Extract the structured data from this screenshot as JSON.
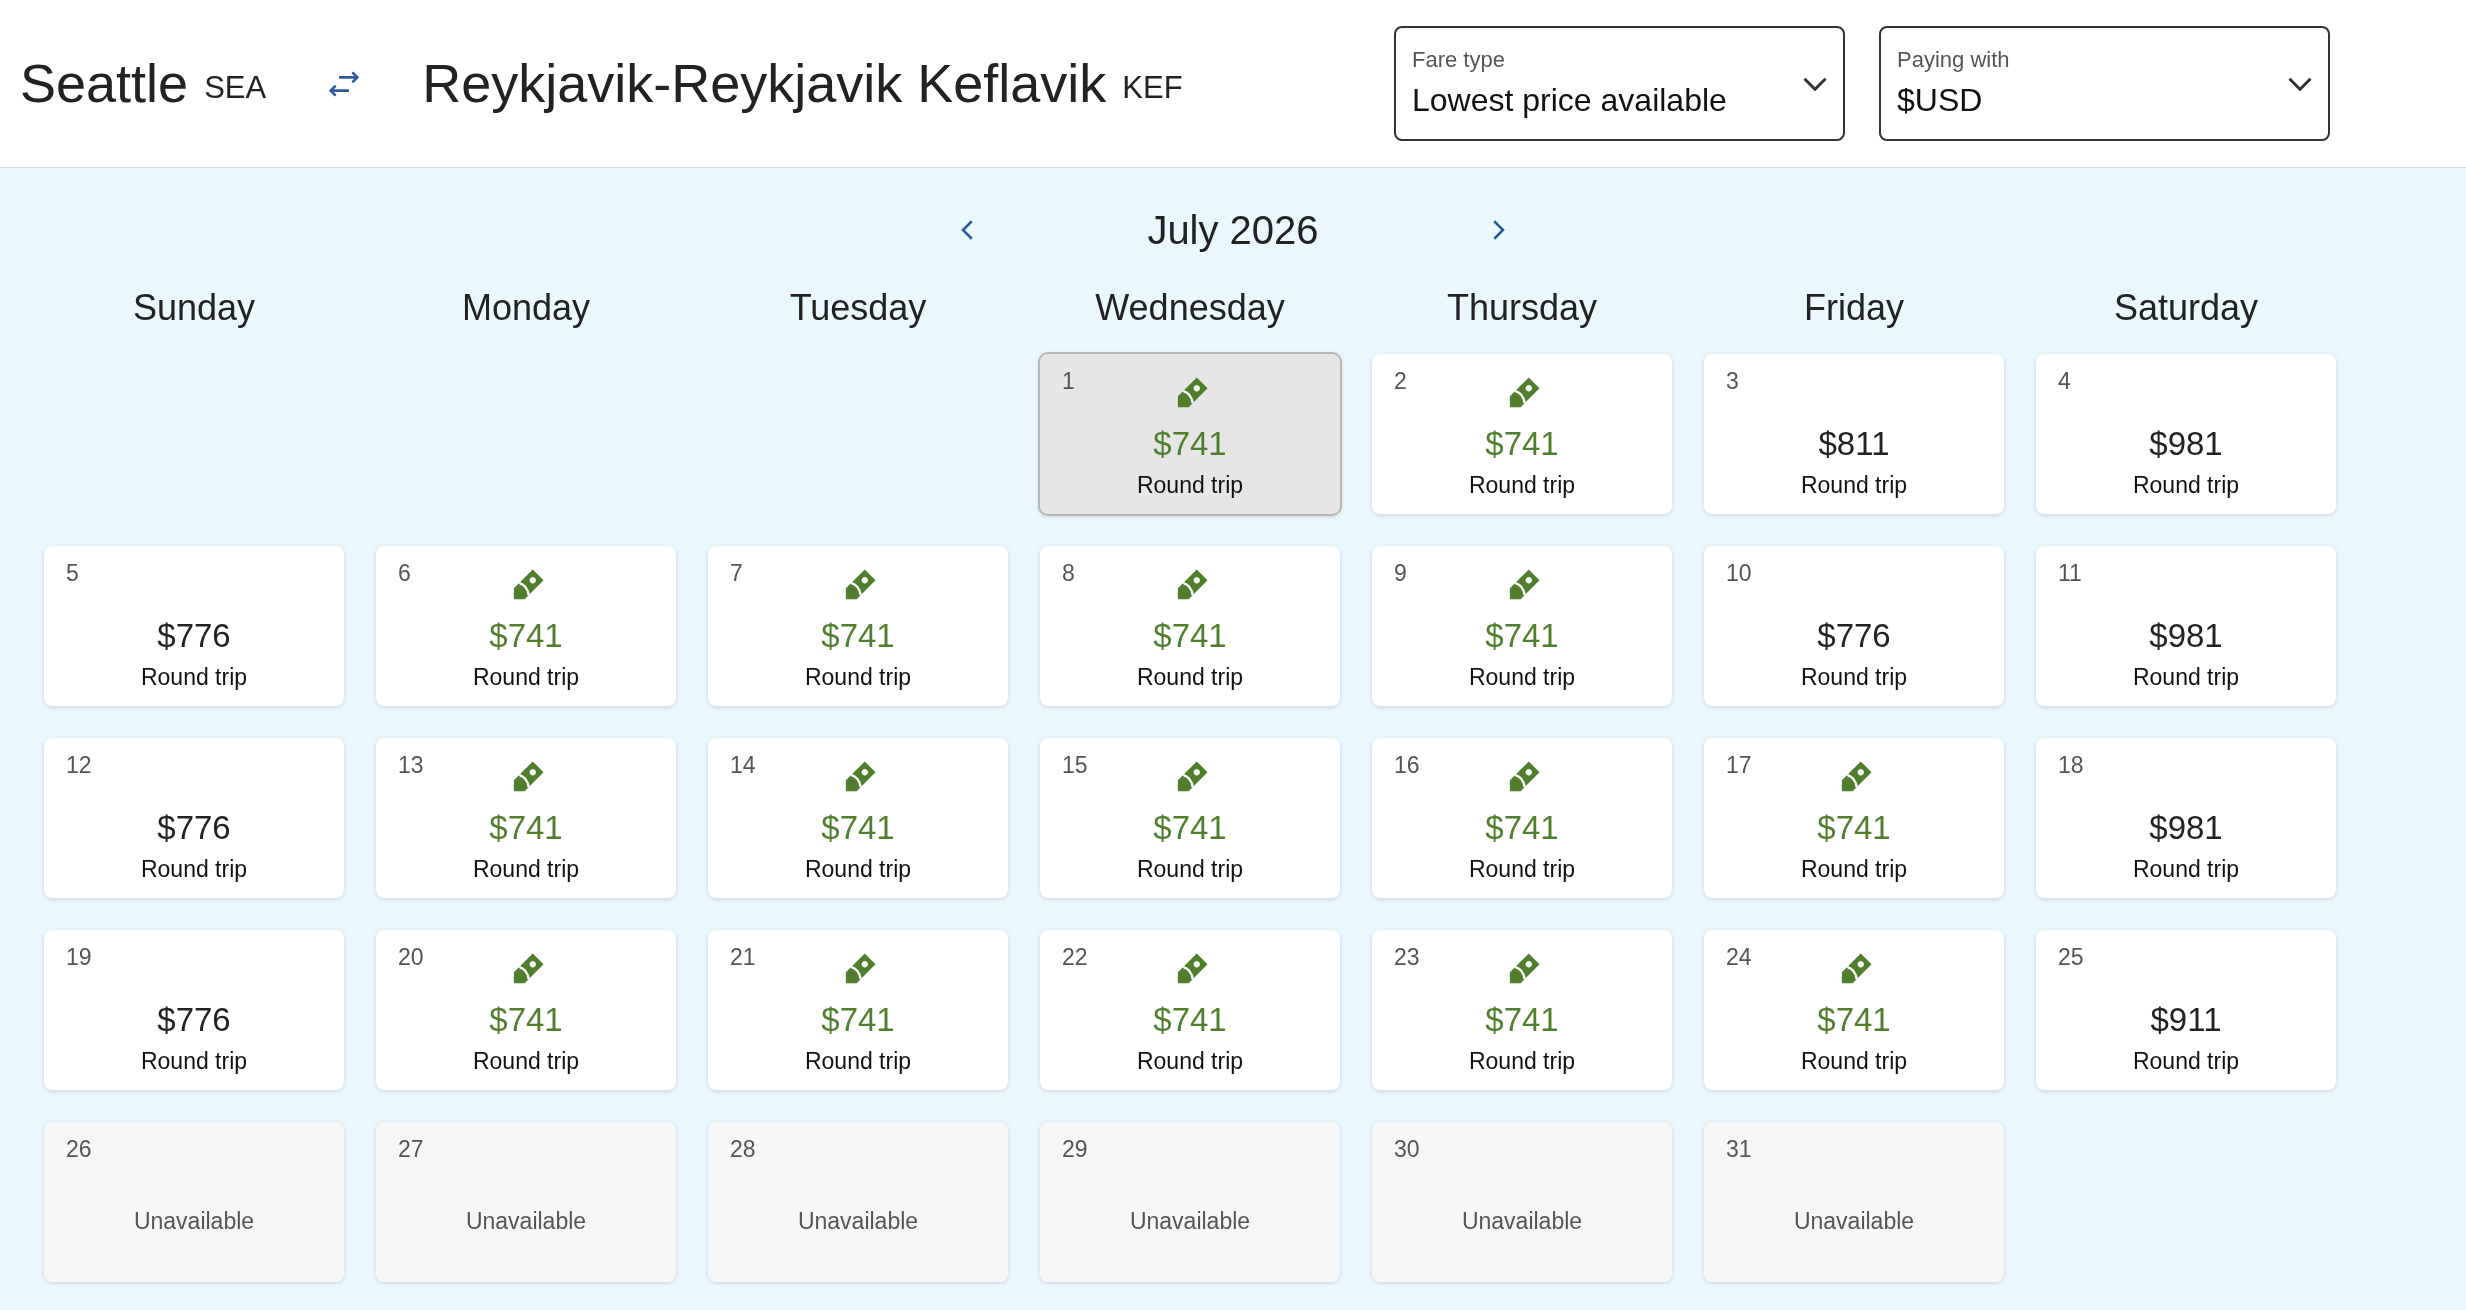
{
  "header": {
    "origin": {
      "city": "Seattle",
      "code": "SEA"
    },
    "destination": {
      "city": "Reykjavik-Reykjavik Keflavik",
      "code": "KEF"
    },
    "dropdowns": [
      {
        "label": "Fare type",
        "value": "Lowest price available"
      },
      {
        "label": "Paying with",
        "value": "$USD"
      }
    ]
  },
  "calendar": {
    "month": "July 2026",
    "weekdays": [
      "Sunday",
      "Monday",
      "Tuesday",
      "Wednesday",
      "Thursday",
      "Friday",
      "Saturday"
    ],
    "weeks": [
      [
        {
          "day": "1",
          "kind": "deal",
          "price": "$741",
          "note": "Round trip",
          "selected": true
        },
        {
          "day": "2",
          "kind": "deal",
          "price": "$741",
          "note": "Round trip",
          "selected": false
        },
        {
          "day": "3",
          "kind": "regular",
          "price": "$811",
          "note": "Round trip",
          "selected": false
        },
        {
          "day": "4",
          "kind": "regular",
          "price": "$981",
          "note": "Round trip",
          "selected": false
        }
      ],
      [
        {
          "day": "5",
          "kind": "regular",
          "price": "$776",
          "note": "Round trip",
          "selected": false
        },
        {
          "day": "6",
          "kind": "deal",
          "price": "$741",
          "note": "Round trip",
          "selected": false
        },
        {
          "day": "7",
          "kind": "deal",
          "price": "$741",
          "note": "Round trip",
          "selected": false
        },
        {
          "day": "8",
          "kind": "deal",
          "price": "$741",
          "note": "Round trip",
          "selected": false
        },
        {
          "day": "9",
          "kind": "deal",
          "price": "$741",
          "note": "Round trip",
          "selected": false
        },
        {
          "day": "10",
          "kind": "regular",
          "price": "$776",
          "note": "Round trip",
          "selected": false
        },
        {
          "day": "11",
          "kind": "regular",
          "price": "$981",
          "note": "Round trip",
          "selected": false
        }
      ],
      [
        {
          "day": "12",
          "kind": "regular",
          "price": "$776",
          "note": "Round trip",
          "selected": false
        },
        {
          "day": "13",
          "kind": "deal",
          "price": "$741",
          "note": "Round trip",
          "selected": false
        },
        {
          "day": "14",
          "kind": "deal",
          "price": "$741",
          "note": "Round trip",
          "selected": false
        },
        {
          "day": "15",
          "kind": "deal",
          "price": "$741",
          "note": "Round trip",
          "selected": false
        },
        {
          "day": "16",
          "kind": "deal",
          "price": "$741",
          "note": "Round trip",
          "selected": false
        },
        {
          "day": "17",
          "kind": "deal",
          "price": "$741",
          "note": "Round trip",
          "selected": false
        },
        {
          "day": "18",
          "kind": "regular",
          "price": "$981",
          "note": "Round trip",
          "selected": false
        }
      ],
      [
        {
          "day": "19",
          "kind": "regular",
          "price": "$776",
          "note": "Round trip",
          "selected": false
        },
        {
          "day": "20",
          "kind": "deal",
          "price": "$741",
          "note": "Round trip",
          "selected": false
        },
        {
          "day": "21",
          "kind": "deal",
          "price": "$741",
          "note": "Round trip",
          "selected": false
        },
        {
          "day": "22",
          "kind": "deal",
          "price": "$741",
          "note": "Round trip",
          "selected": false
        },
        {
          "day": "23",
          "kind": "deal",
          "price": "$741",
          "note": "Round trip",
          "selected": false
        },
        {
          "day": "24",
          "kind": "deal",
          "price": "$741",
          "note": "Round trip",
          "selected": false
        },
        {
          "day": "25",
          "kind": "regular",
          "price": "$911",
          "note": "Round trip",
          "selected": false
        }
      ],
      [
        {
          "day": "26",
          "kind": "unavailable",
          "note": "Unavailable",
          "selected": false
        },
        {
          "day": "27",
          "kind": "unavailable",
          "note": "Unavailable",
          "selected": false
        },
        {
          "day": "28",
          "kind": "unavailable",
          "note": "Unavailable",
          "selected": false
        },
        {
          "day": "29",
          "kind": "unavailable",
          "note": "Unavailable",
          "selected": false
        },
        {
          "day": "30",
          "kind": "unavailable",
          "note": "Unavailable",
          "selected": false
        },
        {
          "day": "31",
          "kind": "unavailable",
          "note": "Unavailable",
          "selected": false
        }
      ]
    ]
  }
}
